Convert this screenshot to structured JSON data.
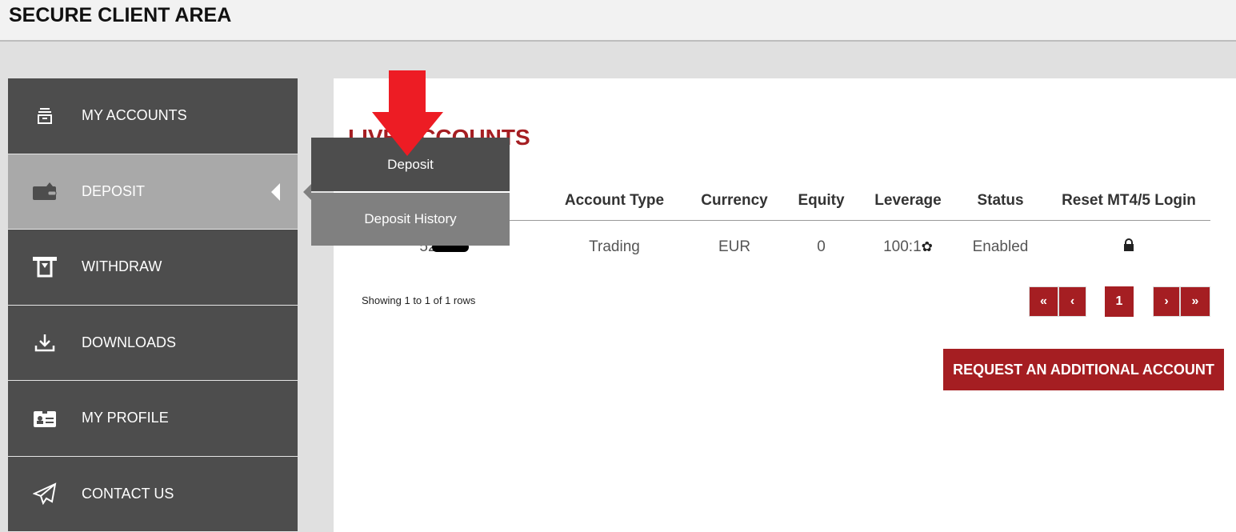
{
  "header": {
    "title": "SECURE CLIENT AREA"
  },
  "sidebar": {
    "items": [
      {
        "label": "MY ACCOUNTS",
        "icon": "archive-icon"
      },
      {
        "label": "DEPOSIT",
        "icon": "wallet-icon",
        "active": true
      },
      {
        "label": "WITHDRAW",
        "icon": "atm-withdraw-icon"
      },
      {
        "label": "DOWNLOADS",
        "icon": "download-icon"
      },
      {
        "label": "MY PROFILE",
        "icon": "id-card-icon"
      },
      {
        "label": "CONTACT US",
        "icon": "paper-plane-icon"
      }
    ]
  },
  "dropdown": {
    "items": [
      "Deposit",
      "Deposit History"
    ]
  },
  "main": {
    "title": "LIVE ACCOUNTS",
    "columns": [
      "",
      "Account Type",
      "Currency",
      "Equity",
      "Leverage",
      "Status",
      "Reset MT4/5 Login"
    ],
    "rows": [
      {
        "account": "52",
        "type": "Trading",
        "currency": "EUR",
        "equity": "0",
        "leverage": "100:1",
        "status": "Enabled"
      }
    ],
    "showing": "Showing 1 to 1 of 1 rows",
    "pagination": {
      "first": "«",
      "prev": "‹",
      "current": "1",
      "next": "›",
      "last": "»"
    },
    "request_button": "REQUEST AN ADDITIONAL ACCOUNT"
  },
  "colors": {
    "accent": "#a51e22",
    "sidebar": "#4d4d4d",
    "active": "#a9a9a9",
    "arrow": "#ed1c24"
  }
}
